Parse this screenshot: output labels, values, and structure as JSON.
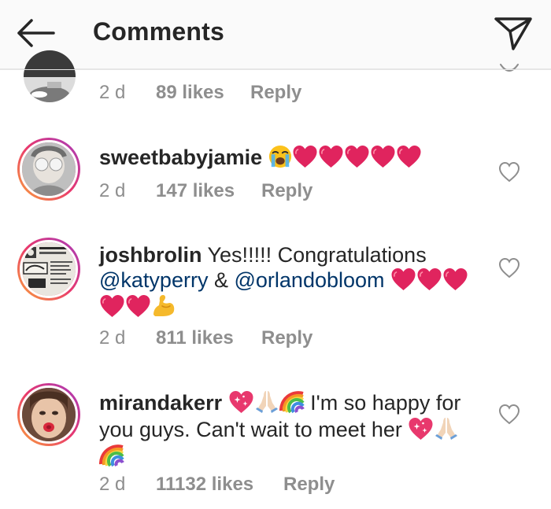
{
  "header": {
    "title": "Comments"
  },
  "comments": [
    {
      "time": "2 d",
      "likes": "89 likes",
      "reply": "Reply"
    },
    {
      "username": "sweetbabyjamie",
      "time": "2 d",
      "likes": "147 likes",
      "reply": "Reply"
    },
    {
      "username": "joshbrolin",
      "text_1": "Yes!!!!! Congratulations",
      "mention_1": "@katyperry",
      "text_2": "&",
      "mention_2": "@orlandobloom",
      "time": "2 d",
      "likes": "811 likes",
      "reply": "Reply"
    },
    {
      "username": "mirandakerr",
      "text_1": "I'm so happy for",
      "text_2": "you guys. Can't wait to meet her",
      "time": "2 d",
      "likes": "11132 likes",
      "reply": "Reply"
    }
  ],
  "colors": {
    "heart_red": "#e0245e",
    "link_blue": "#003569",
    "meta_gray": "#8e8e8e",
    "header_bg": "#fafafa"
  },
  "icons": [
    "back-arrow-icon",
    "send-icon",
    "heart-icon",
    "red-heart-emoji",
    "crying-face-emoji",
    "flexed-biceps-emoji",
    "sparkling-heart-emoji",
    "folded-hands-emoji",
    "rainbow-emoji"
  ]
}
